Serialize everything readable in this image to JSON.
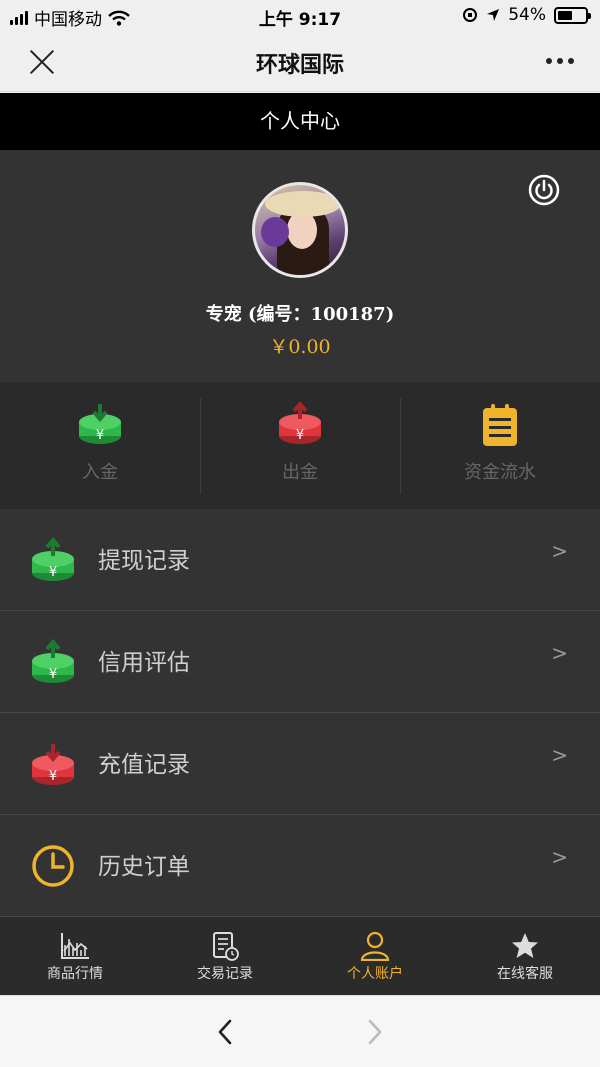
{
  "status_bar": {
    "carrier": "中国移动",
    "time": "上午 9:17",
    "battery": "54%",
    "battery_level": 0.54
  },
  "nav": {
    "title": "环球国际"
  },
  "page": {
    "title": "个人中心"
  },
  "profile": {
    "user_line": "专宠 (编号：100187)",
    "balance": "￥0.00"
  },
  "quick_actions": [
    {
      "label": "入金",
      "icon": "deposit-icon",
      "color": "#2fb84a"
    },
    {
      "label": "出金",
      "icon": "withdraw-icon",
      "color": "#e0353c"
    },
    {
      "label": "资金流水",
      "icon": "clipboard-icon",
      "color": "#f0b42c"
    }
  ],
  "menu": [
    {
      "label": "提现记录",
      "icon": "withdraw-record-icon",
      "arrow": ">"
    },
    {
      "label": "信用评估",
      "icon": "credit-icon",
      "arrow": ">"
    },
    {
      "label": "充值记录",
      "icon": "recharge-record-icon",
      "arrow": ">"
    },
    {
      "label": "历史订单",
      "icon": "clock-icon",
      "arrow": ">"
    }
  ],
  "tabs": [
    {
      "label": "商品行情",
      "icon": "chart-icon"
    },
    {
      "label": "交易记录",
      "icon": "document-icon"
    },
    {
      "label": "个人账户",
      "icon": "user-icon",
      "active": true
    },
    {
      "label": "在线客服",
      "icon": "star-icon"
    }
  ],
  "colors": {
    "accent": "#f0b42c",
    "green": "#2fb84a",
    "red": "#e0353c"
  }
}
